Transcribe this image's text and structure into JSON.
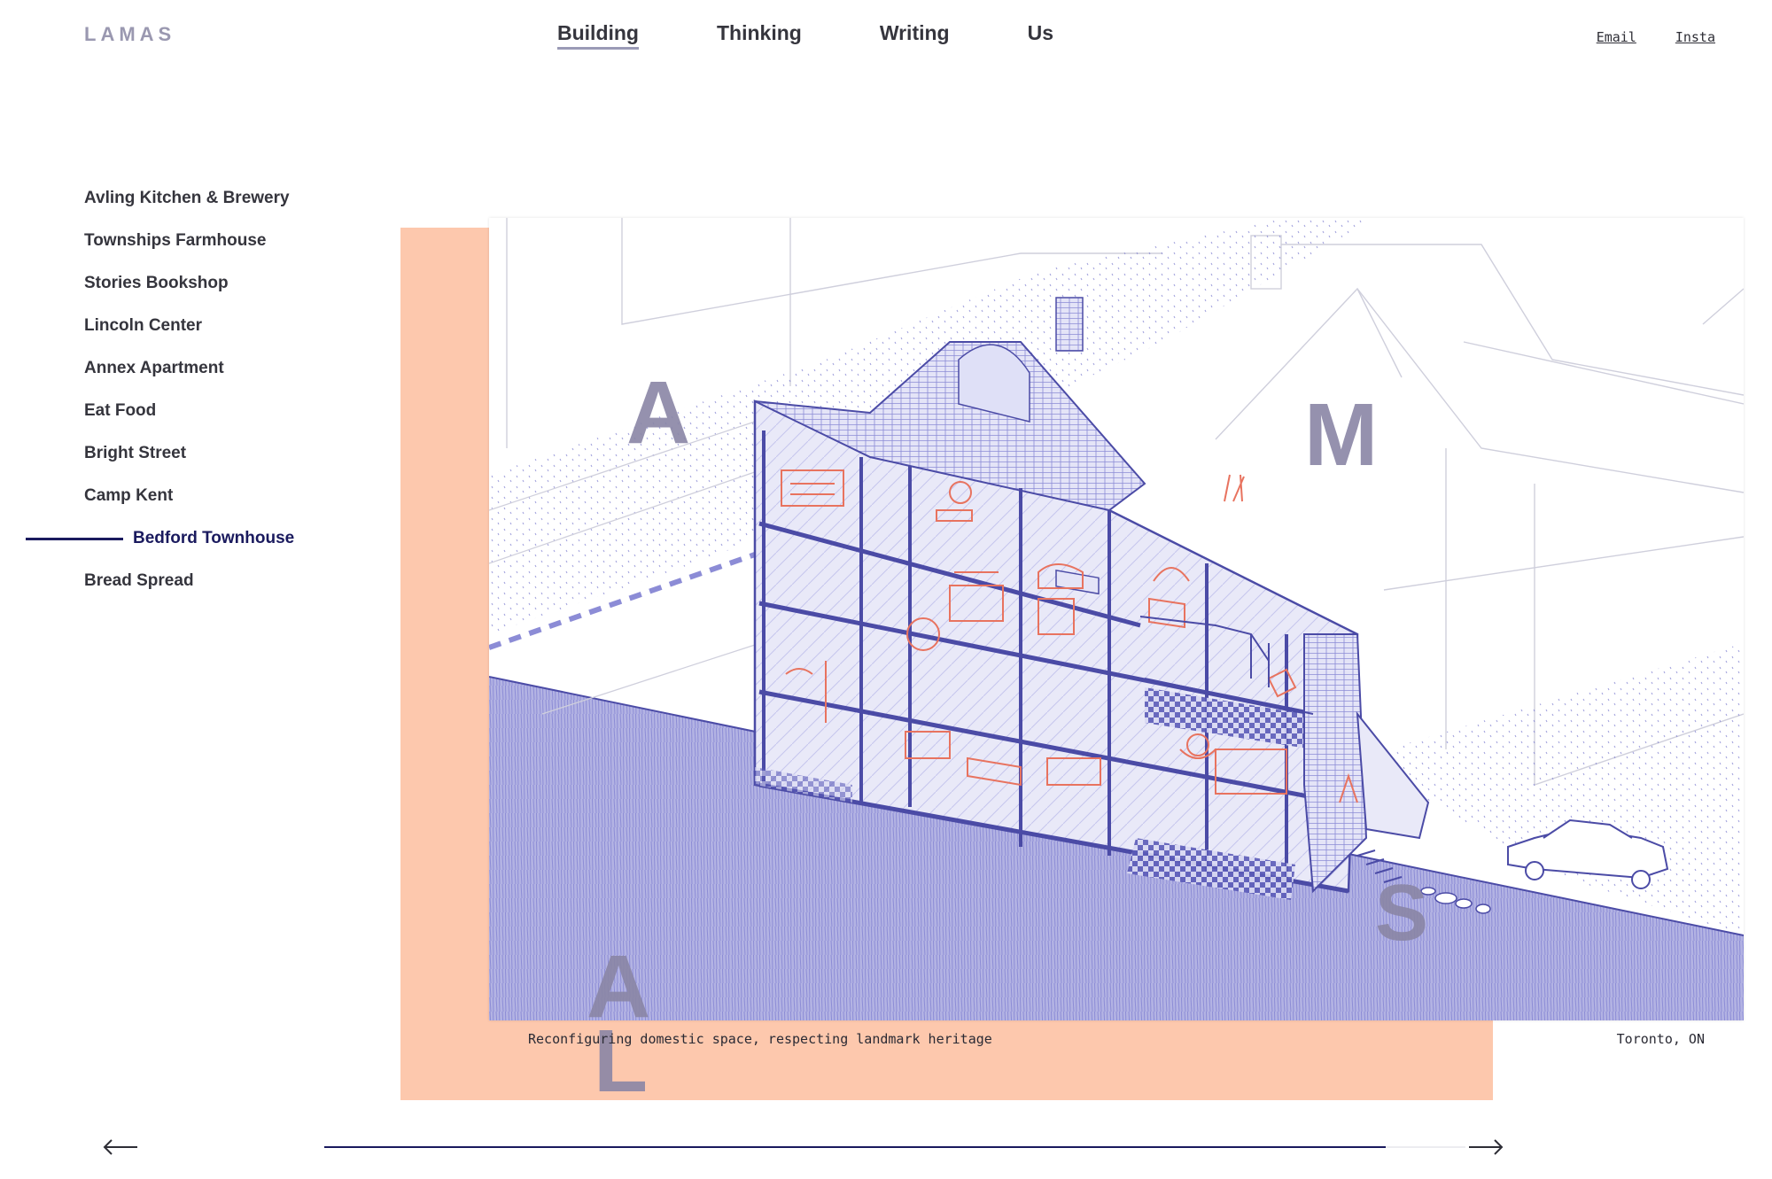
{
  "brand": {
    "logo": "LAMAS"
  },
  "nav": {
    "items": [
      {
        "label": "Building",
        "active": true
      },
      {
        "label": "Thinking"
      },
      {
        "label": "Writing"
      },
      {
        "label": "Us"
      }
    ]
  },
  "links": {
    "email": "Email",
    "insta": "Insta"
  },
  "projects": {
    "items": [
      {
        "label": "Avling Kitchen & Brewery"
      },
      {
        "label": "Townships Farmhouse"
      },
      {
        "label": "Stories Bookshop"
      },
      {
        "label": "Lincoln Center"
      },
      {
        "label": "Annex Apartment"
      },
      {
        "label": "Eat Food"
      },
      {
        "label": "Bright Street"
      },
      {
        "label": "Camp Kent"
      },
      {
        "label": "Bedford Townhouse",
        "active": true
      },
      {
        "label": "Bread Spread"
      }
    ]
  },
  "hero": {
    "letters": {
      "a_top": "A",
      "m": "M",
      "s": "S",
      "a_bottom": "A",
      "l": "L"
    }
  },
  "caption": {
    "text": "Reconfiguring domestic space, respecting landmark heritage",
    "location": "Toronto, ON"
  },
  "carousel": {
    "prev_icon": "arrow-left-icon",
    "next_icon": "arrow-right-icon",
    "progress": 0.93
  },
  "colors": {
    "accent": "#1a1a5e",
    "salmon": "#fdc8ad",
    "illustration_blue": "#6b6bcf",
    "illustration_red": "#e8735f",
    "letter_gray": "#8a86a6"
  }
}
